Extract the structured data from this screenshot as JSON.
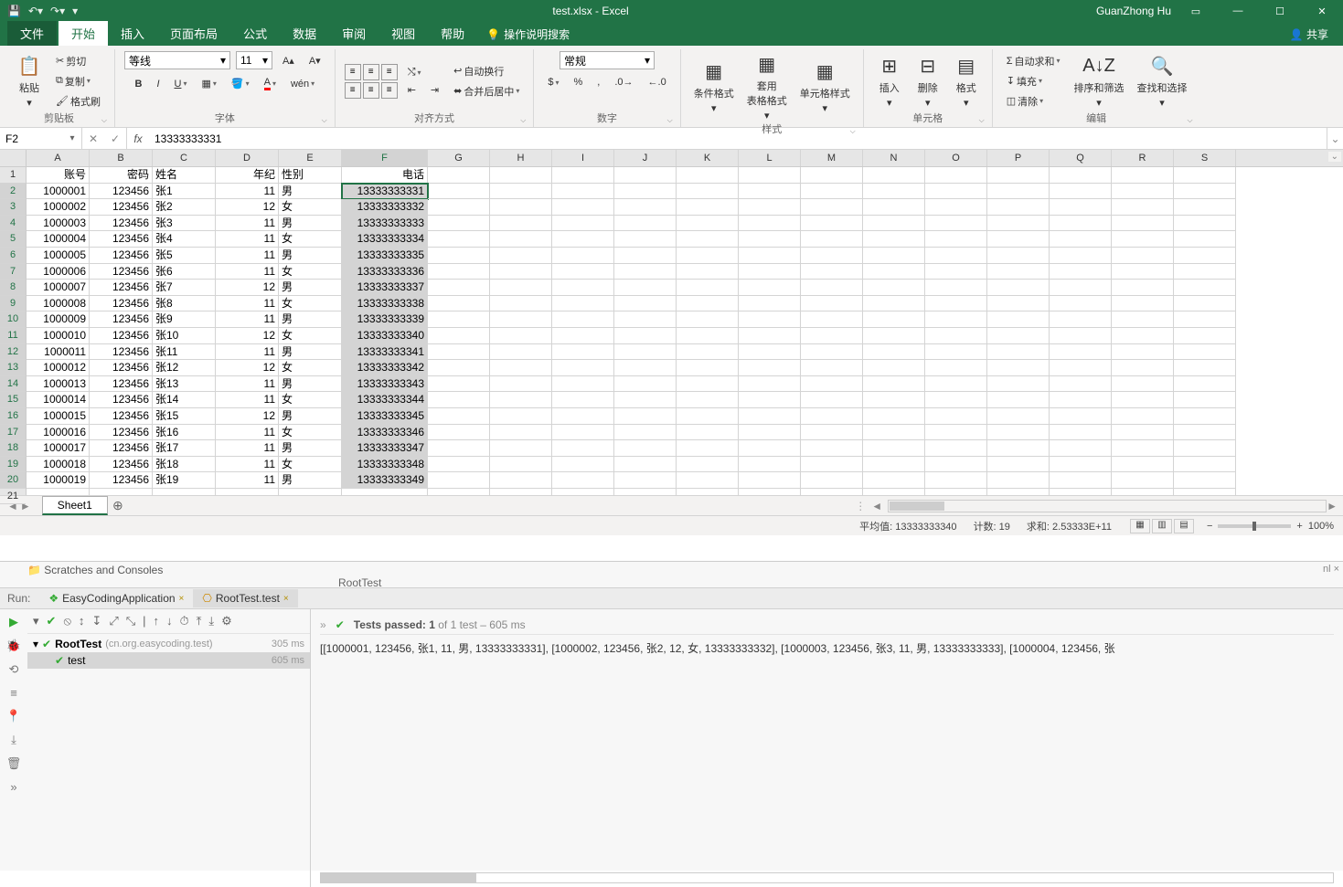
{
  "titlebar": {
    "doc": "test.xlsx  -  Excel",
    "user": "GuanZhong Hu"
  },
  "tabs": {
    "file": "文件",
    "home": "开始",
    "insert": "插入",
    "layout": "页面布局",
    "formulas": "公式",
    "data": "数据",
    "review": "审阅",
    "view": "视图",
    "help": "帮助",
    "tell": "操作说明搜索",
    "share": "共享"
  },
  "ribbon": {
    "clipboard": {
      "label": "剪贴板",
      "paste": "粘贴",
      "cut": "剪切",
      "copy": "复制",
      "painter": "格式刷"
    },
    "font": {
      "label": "字体",
      "name": "等线",
      "size": "11"
    },
    "align": {
      "label": "对齐方式",
      "wrap": "自动换行",
      "merge": "合并后居中"
    },
    "number": {
      "label": "数字",
      "format": "常规"
    },
    "styles": {
      "label": "样式",
      "cond": "条件格式",
      "table": "套用\n表格格式",
      "cell": "单元格样式"
    },
    "cells": {
      "label": "单元格",
      "insert": "插入",
      "delete": "删除",
      "format": "格式"
    },
    "editing": {
      "label": "编辑",
      "sum": "自动求和",
      "fill": "填充",
      "clear": "清除",
      "sort": "排序和筛选",
      "find": "查找和选择"
    }
  },
  "formula": {
    "cell": "F2",
    "value": "13333333331"
  },
  "columns": [
    "A",
    "B",
    "C",
    "D",
    "E",
    "F",
    "G",
    "H",
    "I",
    "J",
    "K",
    "L",
    "M",
    "N",
    "O",
    "P",
    "Q",
    "R",
    "S"
  ],
  "headers": {
    "A": "账号",
    "B": "密码",
    "C": "姓名",
    "D": "年纪",
    "E": "性别",
    "F": "电话"
  },
  "data_rows": [
    {
      "A": "1000001",
      "B": "123456",
      "C": "张1",
      "D": "11",
      "E": "男",
      "F": "13333333331"
    },
    {
      "A": "1000002",
      "B": "123456",
      "C": "张2",
      "D": "12",
      "E": "女",
      "F": "13333333332"
    },
    {
      "A": "1000003",
      "B": "123456",
      "C": "张3",
      "D": "11",
      "E": "男",
      "F": "13333333333"
    },
    {
      "A": "1000004",
      "B": "123456",
      "C": "张4",
      "D": "11",
      "E": "女",
      "F": "13333333334"
    },
    {
      "A": "1000005",
      "B": "123456",
      "C": "张5",
      "D": "11",
      "E": "男",
      "F": "13333333335"
    },
    {
      "A": "1000006",
      "B": "123456",
      "C": "张6",
      "D": "11",
      "E": "女",
      "F": "13333333336"
    },
    {
      "A": "1000007",
      "B": "123456",
      "C": "张7",
      "D": "12",
      "E": "男",
      "F": "13333333337"
    },
    {
      "A": "1000008",
      "B": "123456",
      "C": "张8",
      "D": "11",
      "E": "女",
      "F": "13333333338"
    },
    {
      "A": "1000009",
      "B": "123456",
      "C": "张9",
      "D": "11",
      "E": "男",
      "F": "13333333339"
    },
    {
      "A": "1000010",
      "B": "123456",
      "C": "张10",
      "D": "12",
      "E": "女",
      "F": "13333333340"
    },
    {
      "A": "1000011",
      "B": "123456",
      "C": "张11",
      "D": "11",
      "E": "男",
      "F": "13333333341"
    },
    {
      "A": "1000012",
      "B": "123456",
      "C": "张12",
      "D": "12",
      "E": "女",
      "F": "13333333342"
    },
    {
      "A": "1000013",
      "B": "123456",
      "C": "张13",
      "D": "11",
      "E": "男",
      "F": "13333333343"
    },
    {
      "A": "1000014",
      "B": "123456",
      "C": "张14",
      "D": "11",
      "E": "女",
      "F": "13333333344"
    },
    {
      "A": "1000015",
      "B": "123456",
      "C": "张15",
      "D": "12",
      "E": "男",
      "F": "13333333345"
    },
    {
      "A": "1000016",
      "B": "123456",
      "C": "张16",
      "D": "11",
      "E": "女",
      "F": "13333333346"
    },
    {
      "A": "1000017",
      "B": "123456",
      "C": "张17",
      "D": "11",
      "E": "男",
      "F": "13333333347"
    },
    {
      "A": "1000018",
      "B": "123456",
      "C": "张18",
      "D": "11",
      "E": "女",
      "F": "13333333348"
    },
    {
      "A": "1000019",
      "B": "123456",
      "C": "张19",
      "D": "11",
      "E": "男",
      "F": "13333333349"
    }
  ],
  "sheet": {
    "name": "Sheet1"
  },
  "status": {
    "avg": "平均值: 13333333340",
    "count": "计数: 19",
    "sum": "求和: 2.53333E+11",
    "zoom": "100%"
  },
  "ide": {
    "libs": "Scratches and Consoles",
    "breadcrumb": "RootTest",
    "run_label": "Run:",
    "configs": [
      "EasyCodingApplication",
      "RootTest.test"
    ],
    "tests_line_pre": "Tests passed: 1",
    "tests_line_post": " of 1 test – 605 ms",
    "tree": {
      "root": "RootTest",
      "pkg": "(cn.org.easycoding.test)",
      "root_time": "305 ms",
      "child": "test",
      "child_time": "605 ms"
    },
    "output": "[[1000001, 123456, 张1, 11, 男, 13333333331], [1000002, 123456, 张2, 12, 女, 13333333332], [1000003, 123456, 张3, 11, 男, 13333333333], [1000004, 123456, 张"
  }
}
